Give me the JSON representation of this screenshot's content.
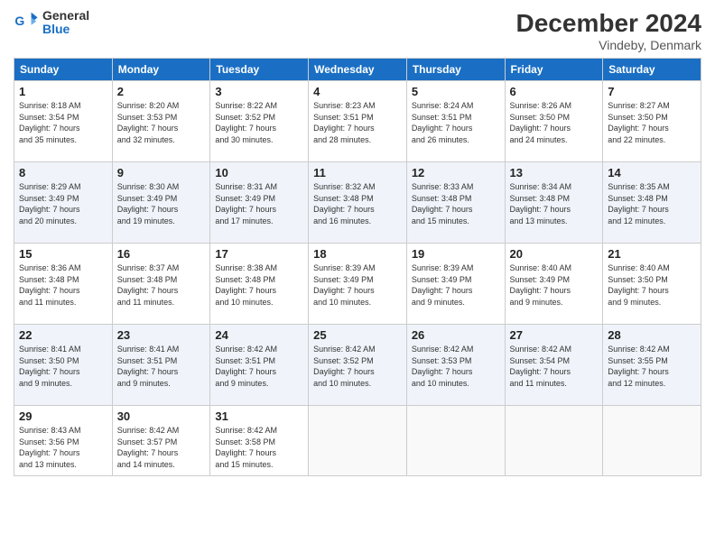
{
  "logo": {
    "line1": "General",
    "line2": "Blue"
  },
  "title": "December 2024",
  "subtitle": "Vindeby, Denmark",
  "headers": [
    "Sunday",
    "Monday",
    "Tuesday",
    "Wednesday",
    "Thursday",
    "Friday",
    "Saturday"
  ],
  "weeks": [
    [
      {
        "day": "1",
        "info": "Sunrise: 8:18 AM\nSunset: 3:54 PM\nDaylight: 7 hours\nand 35 minutes."
      },
      {
        "day": "2",
        "info": "Sunrise: 8:20 AM\nSunset: 3:53 PM\nDaylight: 7 hours\nand 32 minutes."
      },
      {
        "day": "3",
        "info": "Sunrise: 8:22 AM\nSunset: 3:52 PM\nDaylight: 7 hours\nand 30 minutes."
      },
      {
        "day": "4",
        "info": "Sunrise: 8:23 AM\nSunset: 3:51 PM\nDaylight: 7 hours\nand 28 minutes."
      },
      {
        "day": "5",
        "info": "Sunrise: 8:24 AM\nSunset: 3:51 PM\nDaylight: 7 hours\nand 26 minutes."
      },
      {
        "day": "6",
        "info": "Sunrise: 8:26 AM\nSunset: 3:50 PM\nDaylight: 7 hours\nand 24 minutes."
      },
      {
        "day": "7",
        "info": "Sunrise: 8:27 AM\nSunset: 3:50 PM\nDaylight: 7 hours\nand 22 minutes."
      }
    ],
    [
      {
        "day": "8",
        "info": "Sunrise: 8:29 AM\nSunset: 3:49 PM\nDaylight: 7 hours\nand 20 minutes."
      },
      {
        "day": "9",
        "info": "Sunrise: 8:30 AM\nSunset: 3:49 PM\nDaylight: 7 hours\nand 19 minutes."
      },
      {
        "day": "10",
        "info": "Sunrise: 8:31 AM\nSunset: 3:49 PM\nDaylight: 7 hours\nand 17 minutes."
      },
      {
        "day": "11",
        "info": "Sunrise: 8:32 AM\nSunset: 3:48 PM\nDaylight: 7 hours\nand 16 minutes."
      },
      {
        "day": "12",
        "info": "Sunrise: 8:33 AM\nSunset: 3:48 PM\nDaylight: 7 hours\nand 15 minutes."
      },
      {
        "day": "13",
        "info": "Sunrise: 8:34 AM\nSunset: 3:48 PM\nDaylight: 7 hours\nand 13 minutes."
      },
      {
        "day": "14",
        "info": "Sunrise: 8:35 AM\nSunset: 3:48 PM\nDaylight: 7 hours\nand 12 minutes."
      }
    ],
    [
      {
        "day": "15",
        "info": "Sunrise: 8:36 AM\nSunset: 3:48 PM\nDaylight: 7 hours\nand 11 minutes."
      },
      {
        "day": "16",
        "info": "Sunrise: 8:37 AM\nSunset: 3:48 PM\nDaylight: 7 hours\nand 11 minutes."
      },
      {
        "day": "17",
        "info": "Sunrise: 8:38 AM\nSunset: 3:48 PM\nDaylight: 7 hours\nand 10 minutes."
      },
      {
        "day": "18",
        "info": "Sunrise: 8:39 AM\nSunset: 3:49 PM\nDaylight: 7 hours\nand 10 minutes."
      },
      {
        "day": "19",
        "info": "Sunrise: 8:39 AM\nSunset: 3:49 PM\nDaylight: 7 hours\nand 9 minutes."
      },
      {
        "day": "20",
        "info": "Sunrise: 8:40 AM\nSunset: 3:49 PM\nDaylight: 7 hours\nand 9 minutes."
      },
      {
        "day": "21",
        "info": "Sunrise: 8:40 AM\nSunset: 3:50 PM\nDaylight: 7 hours\nand 9 minutes."
      }
    ],
    [
      {
        "day": "22",
        "info": "Sunrise: 8:41 AM\nSunset: 3:50 PM\nDaylight: 7 hours\nand 9 minutes."
      },
      {
        "day": "23",
        "info": "Sunrise: 8:41 AM\nSunset: 3:51 PM\nDaylight: 7 hours\nand 9 minutes."
      },
      {
        "day": "24",
        "info": "Sunrise: 8:42 AM\nSunset: 3:51 PM\nDaylight: 7 hours\nand 9 minutes."
      },
      {
        "day": "25",
        "info": "Sunrise: 8:42 AM\nSunset: 3:52 PM\nDaylight: 7 hours\nand 10 minutes."
      },
      {
        "day": "26",
        "info": "Sunrise: 8:42 AM\nSunset: 3:53 PM\nDaylight: 7 hours\nand 10 minutes."
      },
      {
        "day": "27",
        "info": "Sunrise: 8:42 AM\nSunset: 3:54 PM\nDaylight: 7 hours\nand 11 minutes."
      },
      {
        "day": "28",
        "info": "Sunrise: 8:42 AM\nSunset: 3:55 PM\nDaylight: 7 hours\nand 12 minutes."
      }
    ],
    [
      {
        "day": "29",
        "info": "Sunrise: 8:43 AM\nSunset: 3:56 PM\nDaylight: 7 hours\nand 13 minutes."
      },
      {
        "day": "30",
        "info": "Sunrise: 8:42 AM\nSunset: 3:57 PM\nDaylight: 7 hours\nand 14 minutes."
      },
      {
        "day": "31",
        "info": "Sunrise: 8:42 AM\nSunset: 3:58 PM\nDaylight: 7 hours\nand 15 minutes."
      },
      {
        "day": "",
        "info": ""
      },
      {
        "day": "",
        "info": ""
      },
      {
        "day": "",
        "info": ""
      },
      {
        "day": "",
        "info": ""
      }
    ]
  ]
}
